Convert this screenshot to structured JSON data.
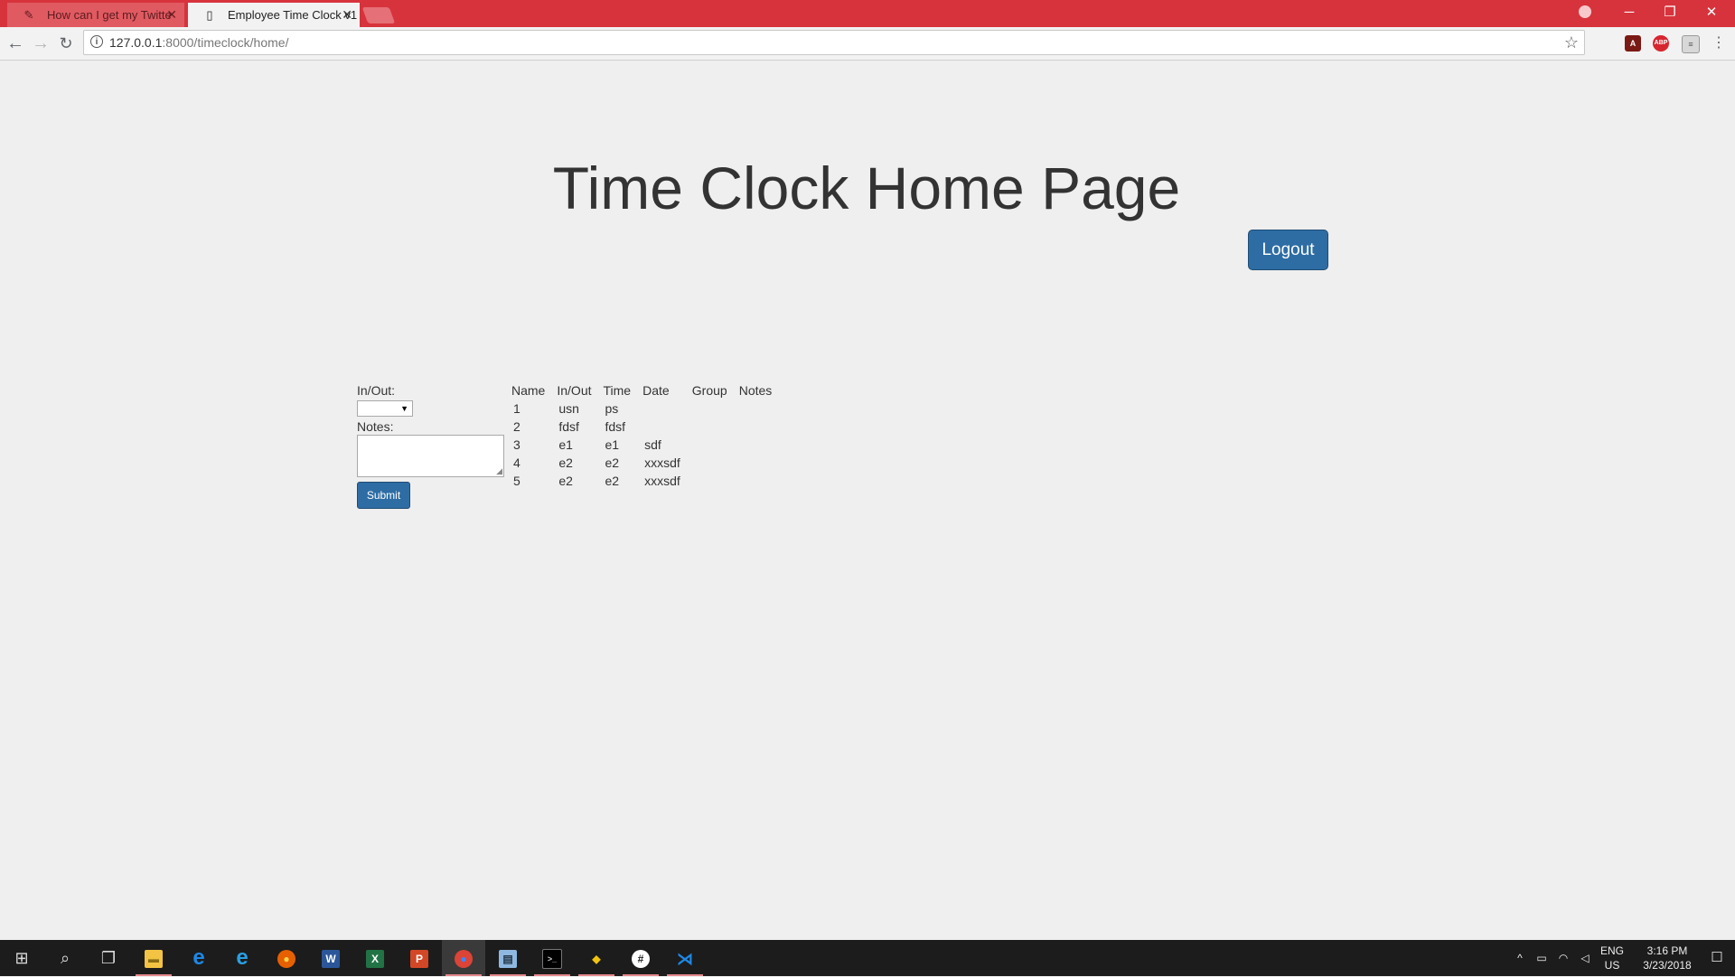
{
  "browser": {
    "tabs": [
      {
        "title": "How can I get my Twitte",
        "active": false
      },
      {
        "title": "Employee Time Clock v1",
        "active": true
      }
    ],
    "url_host": "127.0.0.1",
    "url_rest": ":8000/timeclock/home/"
  },
  "page": {
    "title": "Time Clock Home Page",
    "logout_label": "Logout",
    "form": {
      "inout_label": "In/Out:",
      "notes_label": "Notes:",
      "submit_label": "Submit"
    },
    "table": {
      "headers": [
        "Name",
        "In/Out",
        "Time",
        "Date",
        "Group",
        "Notes"
      ],
      "rows": [
        [
          "1",
          "usn",
          "ps",
          "",
          "",
          ""
        ],
        [
          "2",
          "fdsf",
          "fdsf",
          "",
          "",
          ""
        ],
        [
          "3",
          "e1",
          "e1",
          "sdf",
          "",
          ""
        ],
        [
          "4",
          "e2",
          "e2",
          "xxxsdf",
          "",
          ""
        ],
        [
          "5",
          "e2",
          "e2",
          "xxxsdf",
          "",
          ""
        ]
      ]
    }
  },
  "taskbar": {
    "lang_top": "ENG",
    "lang_bottom": "US",
    "time": "3:16 PM",
    "date": "3/23/2018"
  },
  "colors": {
    "titlebar": "#d7333c",
    "button_primary": "#2e6da4",
    "page_bg": "#efefef"
  },
  "icons": [
    "twitter-favicon",
    "page-favicon",
    "back-icon",
    "forward-icon",
    "reload-icon",
    "info-icon",
    "star-icon",
    "pdf-extension-icon",
    "adblock-icon",
    "reader-icon",
    "menu-icon",
    "windows-start-icon",
    "search-icon",
    "task-view-icon",
    "file-explorer-icon",
    "edge-icon",
    "ie-icon",
    "firefox-icon",
    "word-icon",
    "excel-icon",
    "powerpoint-icon",
    "chrome-icon",
    "notepad-icon",
    "terminal-icon",
    "git-icon",
    "slack-icon",
    "vscode-icon"
  ]
}
